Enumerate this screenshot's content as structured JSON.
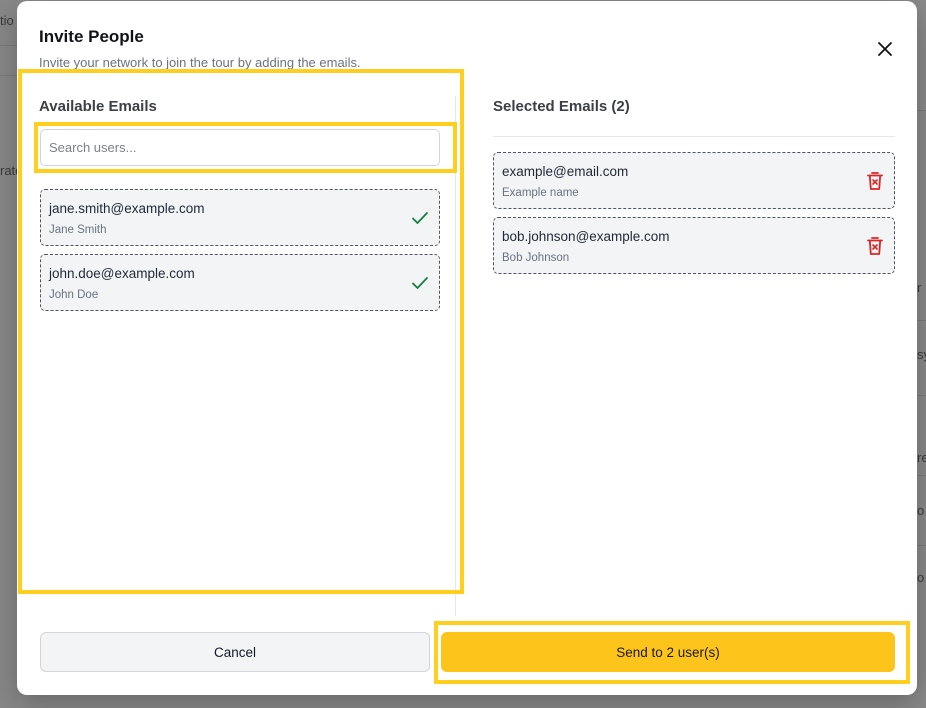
{
  "background": {
    "fragments": [
      "tio",
      "rato",
      "r",
      "sy",
      "re",
      "o",
      "o"
    ]
  },
  "modal": {
    "title": "Invite People",
    "subtitle": "Invite your network to join the tour by adding the emails.",
    "close_icon": "close-icon"
  },
  "available": {
    "title": "Available Emails",
    "search_placeholder": "Search users...",
    "search_value": "",
    "items": [
      {
        "email": "jane.smith@example.com",
        "name": "Jane Smith",
        "icon": "check-icon"
      },
      {
        "email": "john.doe@example.com",
        "name": "John Doe",
        "icon": "check-icon"
      }
    ]
  },
  "selected": {
    "title": "Selected Emails (2)",
    "items": [
      {
        "email": "example@email.com",
        "name": "Example name",
        "icon": "trash-icon"
      },
      {
        "email": "bob.johnson@example.com",
        "name": "Bob Johnson",
        "icon": "trash-icon"
      }
    ]
  },
  "footer": {
    "cancel_label": "Cancel",
    "send_label": "Send to 2 user(s)"
  },
  "colors": {
    "accent": "#fdc51c",
    "highlight": "#ffcf1f",
    "check": "#15803d",
    "delete": "#dc2626"
  }
}
